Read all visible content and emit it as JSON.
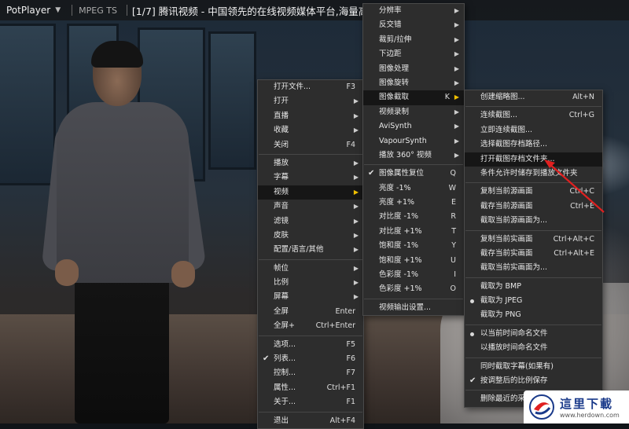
{
  "window": {
    "app_name": "PotPlayer",
    "format": "MPEG TS",
    "title": "[1/7] 腾讯视频 - 中国领先的在线视频媒体平台,海量高清视频在线观"
  },
  "main_menu": [
    {
      "label": "打开文件...",
      "shortcut": "F3"
    },
    {
      "label": "打开",
      "arrow": true
    },
    {
      "label": "直播",
      "arrow": true
    },
    {
      "label": "收藏",
      "arrow": true
    },
    {
      "label": "关闭",
      "shortcut": "F4"
    },
    {
      "sep": true
    },
    {
      "label": "播放",
      "arrow": true
    },
    {
      "label": "字幕",
      "arrow": true
    },
    {
      "label": "视频",
      "arrow": true,
      "highlighted": true
    },
    {
      "label": "声音",
      "arrow": true
    },
    {
      "label": "滤镜",
      "arrow": true
    },
    {
      "label": "皮肤",
      "arrow": true
    },
    {
      "label": "配置/语言/其他",
      "arrow": true
    },
    {
      "sep": true
    },
    {
      "label": "帧位",
      "arrow": true
    },
    {
      "label": "比例",
      "arrow": true
    },
    {
      "label": "屏幕",
      "arrow": true
    },
    {
      "label": "全屏",
      "shortcut": "Enter"
    },
    {
      "label": "全屏+",
      "shortcut": "Ctrl+Enter"
    },
    {
      "sep": true
    },
    {
      "label": "选项...",
      "shortcut": "F5"
    },
    {
      "label": "列表...",
      "shortcut": "F6",
      "checked": true
    },
    {
      "label": "控制...",
      "shortcut": "F7"
    },
    {
      "label": "属性...",
      "shortcut": "Ctrl+F1"
    },
    {
      "label": "关于...",
      "shortcut": "F1"
    },
    {
      "sep": true
    },
    {
      "label": "退出",
      "shortcut": "Alt+F4"
    }
  ],
  "video_menu": [
    {
      "label": "分辨率",
      "arrow": true
    },
    {
      "label": "反交错",
      "arrow": true
    },
    {
      "label": "裁剪/拉伸",
      "arrow": true
    },
    {
      "label": "下边距",
      "arrow": true
    },
    {
      "label": "图像处理",
      "arrow": true
    },
    {
      "label": "图像旋转",
      "arrow": true
    },
    {
      "label": "图像截取",
      "shortcut": "K",
      "arrow": true,
      "highlighted": true
    },
    {
      "label": "视频录制",
      "arrow": true
    },
    {
      "label": "AviSynth",
      "arrow": true
    },
    {
      "label": "VapourSynth",
      "arrow": true
    },
    {
      "label": "播放 360° 视频",
      "arrow": true
    },
    {
      "sep": true
    },
    {
      "label": "图像属性复位",
      "shortcut": "Q",
      "checked": true
    },
    {
      "label": "亮度 -1%",
      "shortcut": "W"
    },
    {
      "label": "亮度 +1%",
      "shortcut": "E"
    },
    {
      "label": "对比度 -1%",
      "shortcut": "R"
    },
    {
      "label": "对比度 +1%",
      "shortcut": "T"
    },
    {
      "label": "饱和度 -1%",
      "shortcut": "Y"
    },
    {
      "label": "饱和度 +1%",
      "shortcut": "U"
    },
    {
      "label": "色彩度 -1%",
      "shortcut": "I"
    },
    {
      "label": "色彩度 +1%",
      "shortcut": "O"
    },
    {
      "sep": true
    },
    {
      "label": "视频输出设置..."
    }
  ],
  "capture_menu": [
    {
      "label": "创建缩略图...",
      "shortcut": "Alt+N"
    },
    {
      "sep": true
    },
    {
      "label": "连续截图...",
      "shortcut": "Ctrl+G"
    },
    {
      "label": "立即连续截图..."
    },
    {
      "label": "选择截图存档路径..."
    },
    {
      "label": "打开截图存档文件夹...",
      "highlighted": true
    },
    {
      "label": "条件允许时储存到播放文件夹"
    },
    {
      "sep": true
    },
    {
      "label": "复制当前源画面",
      "shortcut": "Ctrl+C"
    },
    {
      "label": "截存当前源画面",
      "shortcut": "Ctrl+E"
    },
    {
      "label": "截取当前源画面为..."
    },
    {
      "sep": true
    },
    {
      "label": "复制当前实画面",
      "shortcut": "Ctrl+Alt+C"
    },
    {
      "label": "截存当前实画面",
      "shortcut": "Ctrl+Alt+E"
    },
    {
      "label": "截取当前实画面为..."
    },
    {
      "sep": true
    },
    {
      "label": "截取为 BMP"
    },
    {
      "label": "截取为 JPEG",
      "radio": true
    },
    {
      "label": "截取为 PNG"
    },
    {
      "sep": true
    },
    {
      "label": "以当前时间命名文件",
      "radio": true
    },
    {
      "label": "以播放时间命名文件"
    },
    {
      "sep": true
    },
    {
      "label": "同时截取字幕(如果有)"
    },
    {
      "label": "按调整后的比例保存",
      "checked": true
    },
    {
      "sep": true
    },
    {
      "label": "删除最近的采"
    }
  ],
  "watermark": {
    "name": "這里下載",
    "url": "www.herdown.com"
  },
  "colors": {
    "menu_bg": "#2d2d2d",
    "highlight_bg": "#161616",
    "submenu_arrow_active": "#f0c000",
    "annotation_arrow": "#e02020"
  }
}
